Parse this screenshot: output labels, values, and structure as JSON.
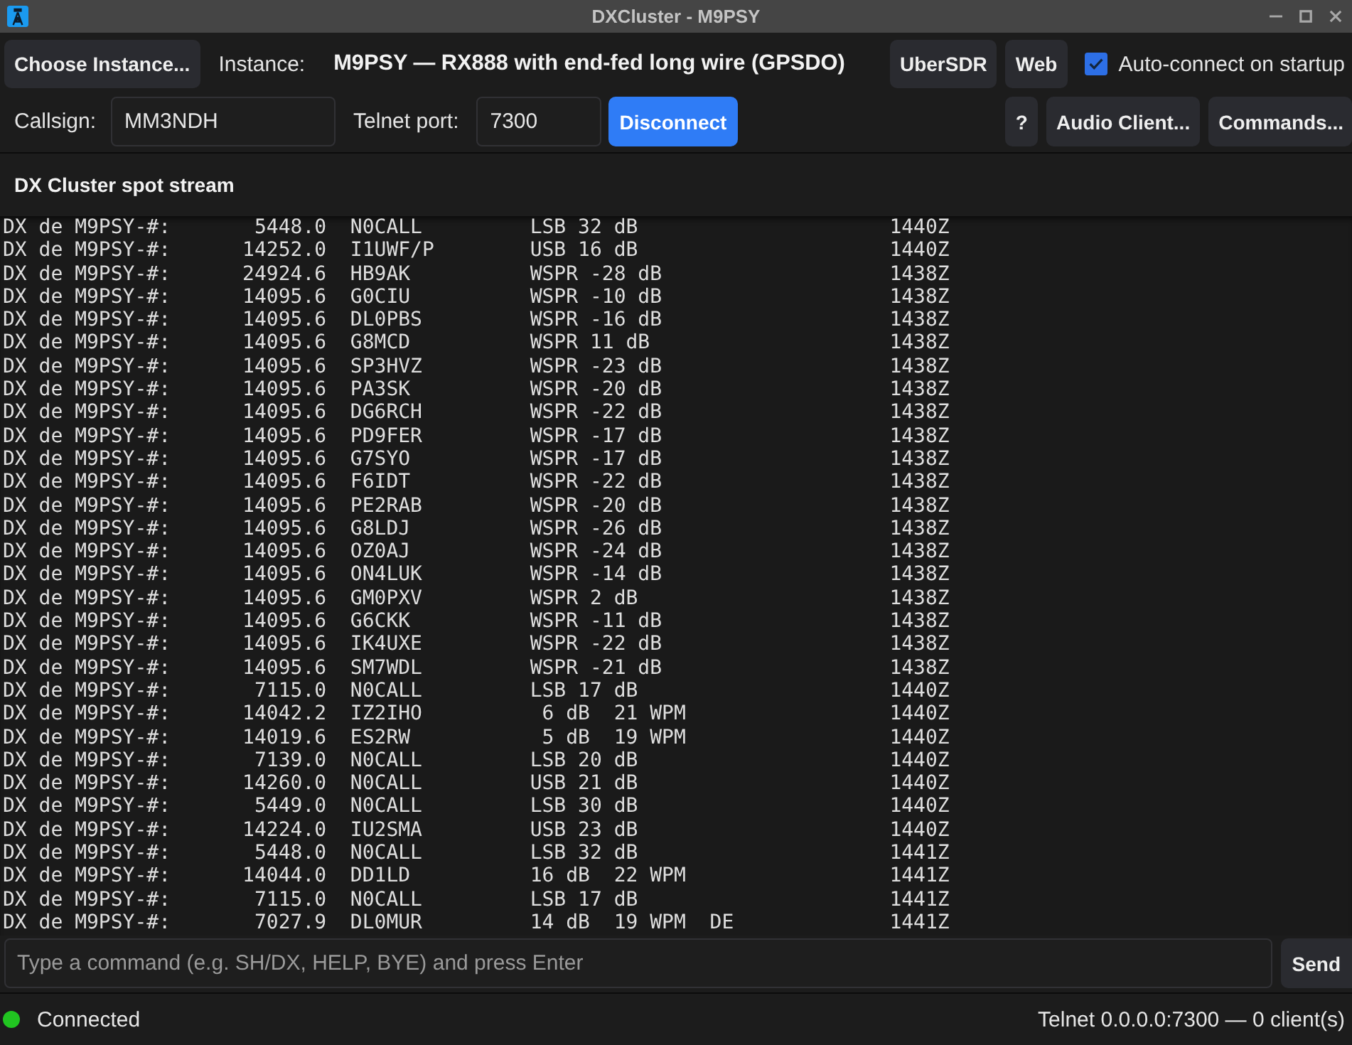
{
  "window": {
    "title": "DXCluster - M9PSY"
  },
  "toolbar": {
    "choose_button": "Choose Instance...",
    "instance_label": "Instance:",
    "instance_value": "M9PSY — RX888 with end-fed long wire (GPSDO)",
    "ubersdr_button": "UberSDR",
    "web_button": "Web",
    "auto_connect": {
      "label": "Auto-connect on startup",
      "checked": true
    }
  },
  "connection": {
    "callsign_label": "Callsign:",
    "callsign": "MM3NDH",
    "port_label": "Telnet port:",
    "port": "7300",
    "connect_button": "Disconnect",
    "help_button": "?",
    "audio_client_button": "Audio Client...",
    "commands_button": "Commands..."
  },
  "spot_stream": {
    "title": "DX Cluster spot stream",
    "lines": [
      {
        "spotter": "DX de M9PSY-#:",
        "freq": "5448.0",
        "call": "N0CALL",
        "comment": "LSB 32 dB",
        "time": "1440Z"
      },
      {
        "spotter": "DX de M9PSY-#:",
        "freq": "14252.0",
        "call": "I1UWF/P",
        "comment": "USB 16 dB",
        "time": "1440Z"
      },
      {
        "spotter": "DX de M9PSY-#:",
        "freq": "24924.6",
        "call": "HB9AK",
        "comment": "WSPR -28 dB",
        "time": "1438Z"
      },
      {
        "spotter": "DX de M9PSY-#:",
        "freq": "14095.6",
        "call": "G0CIU",
        "comment": "WSPR -10 dB",
        "time": "1438Z"
      },
      {
        "spotter": "DX de M9PSY-#:",
        "freq": "14095.6",
        "call": "DL0PBS",
        "comment": "WSPR -16 dB",
        "time": "1438Z"
      },
      {
        "spotter": "DX de M9PSY-#:",
        "freq": "14095.6",
        "call": "G8MCD",
        "comment": "WSPR 11 dB",
        "time": "1438Z"
      },
      {
        "spotter": "DX de M9PSY-#:",
        "freq": "14095.6",
        "call": "SP3HVZ",
        "comment": "WSPR -23 dB",
        "time": "1438Z"
      },
      {
        "spotter": "DX de M9PSY-#:",
        "freq": "14095.6",
        "call": "PA3SK",
        "comment": "WSPR -20 dB",
        "time": "1438Z"
      },
      {
        "spotter": "DX de M9PSY-#:",
        "freq": "14095.6",
        "call": "DG6RCH",
        "comment": "WSPR -22 dB",
        "time": "1438Z"
      },
      {
        "spotter": "DX de M9PSY-#:",
        "freq": "14095.6",
        "call": "PD9FER",
        "comment": "WSPR -17 dB",
        "time": "1438Z"
      },
      {
        "spotter": "DX de M9PSY-#:",
        "freq": "14095.6",
        "call": "G7SYO",
        "comment": "WSPR -17 dB",
        "time": "1438Z"
      },
      {
        "spotter": "DX de M9PSY-#:",
        "freq": "14095.6",
        "call": "F6IDT",
        "comment": "WSPR -22 dB",
        "time": "1438Z"
      },
      {
        "spotter": "DX de M9PSY-#:",
        "freq": "14095.6",
        "call": "PE2RAB",
        "comment": "WSPR -20 dB",
        "time": "1438Z"
      },
      {
        "spotter": "DX de M9PSY-#:",
        "freq": "14095.6",
        "call": "G8LDJ",
        "comment": "WSPR -26 dB",
        "time": "1438Z"
      },
      {
        "spotter": "DX de M9PSY-#:",
        "freq": "14095.6",
        "call": "OZ0AJ",
        "comment": "WSPR -24 dB",
        "time": "1438Z"
      },
      {
        "spotter": "DX de M9PSY-#:",
        "freq": "14095.6",
        "call": "ON4LUK",
        "comment": "WSPR -14 dB",
        "time": "1438Z"
      },
      {
        "spotter": "DX de M9PSY-#:",
        "freq": "14095.6",
        "call": "GM0PXV",
        "comment": "WSPR 2 dB",
        "time": "1438Z"
      },
      {
        "spotter": "DX de M9PSY-#:",
        "freq": "14095.6",
        "call": "G6CKK",
        "comment": "WSPR -11 dB",
        "time": "1438Z"
      },
      {
        "spotter": "DX de M9PSY-#:",
        "freq": "14095.6",
        "call": "IK4UXE",
        "comment": "WSPR -22 dB",
        "time": "1438Z"
      },
      {
        "spotter": "DX de M9PSY-#:",
        "freq": "14095.6",
        "call": "SM7WDL",
        "comment": "WSPR -21 dB",
        "time": "1438Z"
      },
      {
        "spotter": "DX de M9PSY-#:",
        "freq": "7115.0",
        "call": "N0CALL",
        "comment": "LSB 17 dB",
        "time": "1440Z"
      },
      {
        "spotter": "DX de M9PSY-#:",
        "freq": "14042.2",
        "call": "IZ2IHO",
        "comment": " 6 dB  21 WPM",
        "time": "1440Z"
      },
      {
        "spotter": "DX de M9PSY-#:",
        "freq": "14019.6",
        "call": "ES2RW",
        "comment": " 5 dB  19 WPM",
        "time": "1440Z"
      },
      {
        "spotter": "DX de M9PSY-#:",
        "freq": "7139.0",
        "call": "N0CALL",
        "comment": "LSB 20 dB",
        "time": "1440Z"
      },
      {
        "spotter": "DX de M9PSY-#:",
        "freq": "14260.0",
        "call": "N0CALL",
        "comment": "USB 21 dB",
        "time": "1440Z"
      },
      {
        "spotter": "DX de M9PSY-#:",
        "freq": "5449.0",
        "call": "N0CALL",
        "comment": "LSB 30 dB",
        "time": "1440Z"
      },
      {
        "spotter": "DX de M9PSY-#:",
        "freq": "14224.0",
        "call": "IU2SMA",
        "comment": "USB 23 dB",
        "time": "1440Z"
      },
      {
        "spotter": "DX de M9PSY-#:",
        "freq": "5448.0",
        "call": "N0CALL",
        "comment": "LSB 32 dB",
        "time": "1441Z"
      },
      {
        "spotter": "DX de M9PSY-#:",
        "freq": "14044.0",
        "call": "DD1LD",
        "comment": "16 dB  22 WPM",
        "time": "1441Z"
      },
      {
        "spotter": "DX de M9PSY-#:",
        "freq": "7115.0",
        "call": "N0CALL",
        "comment": "LSB 17 dB",
        "time": "1441Z"
      },
      {
        "spotter": "DX de M9PSY-#:",
        "freq": "7027.9",
        "call": "DL0MUR",
        "comment": "14 dB  19 WPM  DE",
        "time": "1441Z"
      }
    ]
  },
  "command": {
    "placeholder": "Type a command (e.g. SH/DX, HELP, BYE) and press Enter",
    "send_button": "Send"
  },
  "status_bar": {
    "connected": true,
    "status": "Connected",
    "server": "Telnet 0.0.0.0:7300 — 0 client(s)"
  }
}
